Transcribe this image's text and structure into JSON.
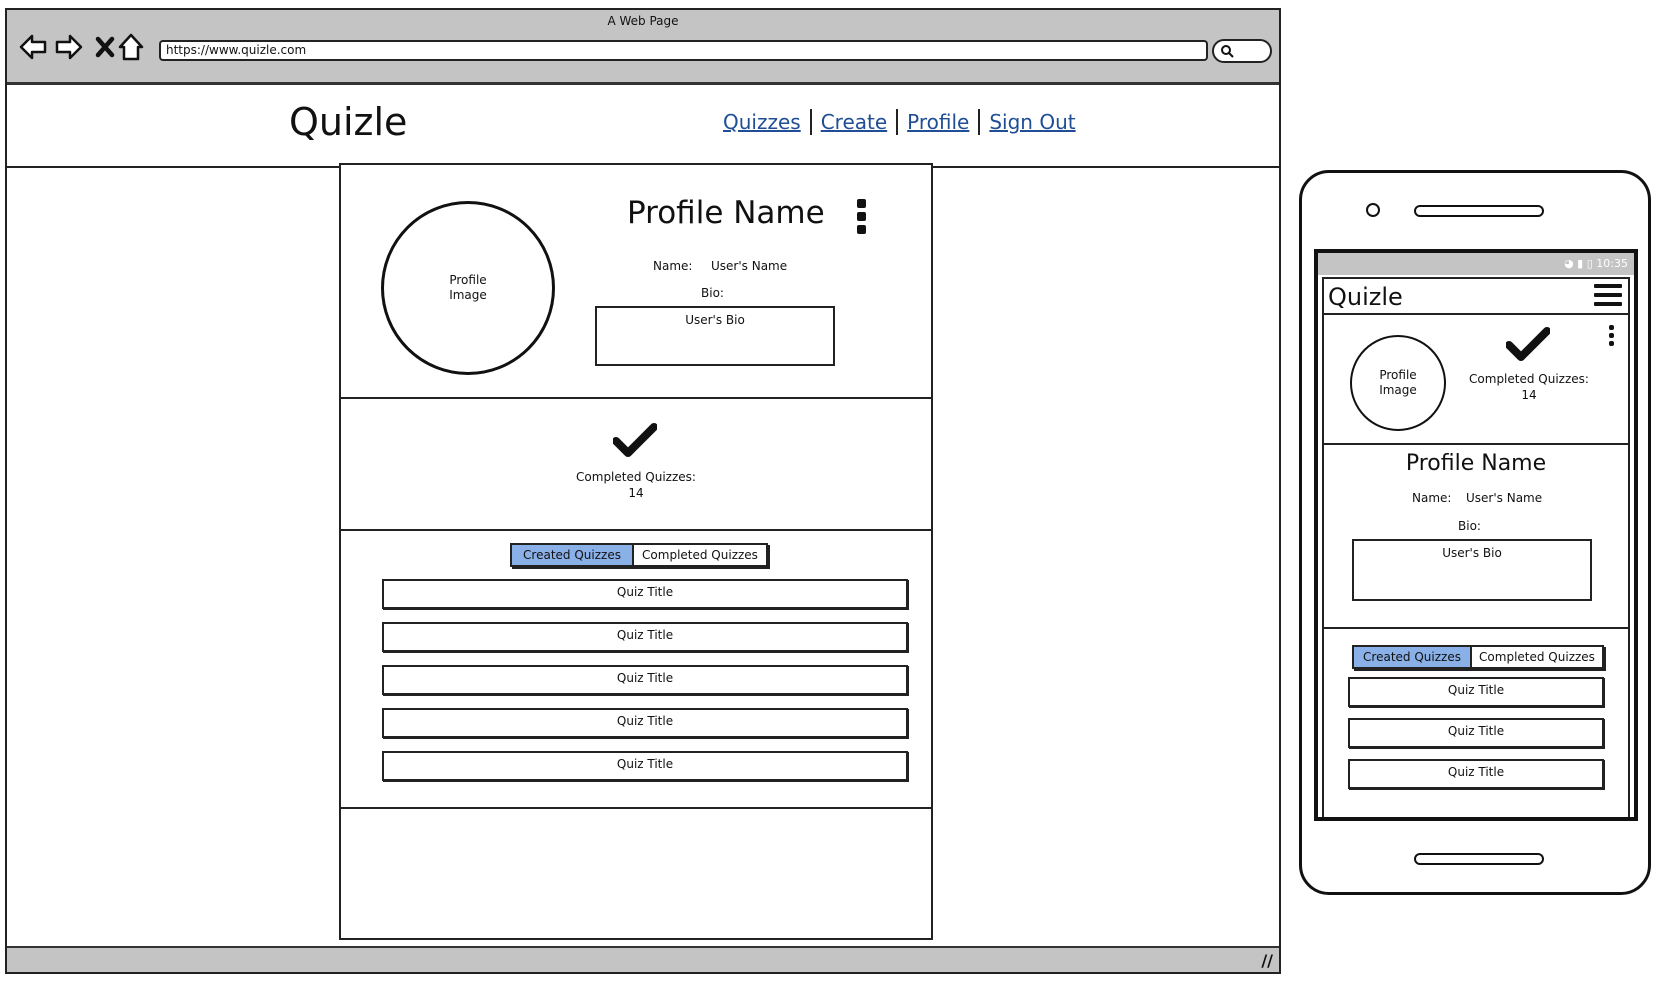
{
  "browser": {
    "window_title": "A Web Page",
    "url": "https://www.quizle.com",
    "icons": [
      "back-arrow-icon",
      "forward-arrow-icon",
      "close-icon",
      "home-icon",
      "search-icon"
    ]
  },
  "site": {
    "logo": "Quizle",
    "nav": [
      "Quizzes",
      "Create",
      "Profile",
      "Sign Out"
    ]
  },
  "profile": {
    "image_label": "Profile Image",
    "name": "Profile Name",
    "name_label": "Name:",
    "name_value": "User's Name",
    "bio_label": "Bio:",
    "bio_value": "User's Bio"
  },
  "stats": {
    "completed_label": "Completed Quizzes:",
    "completed_count": "14"
  },
  "tabs": {
    "created": "Created Quizzes",
    "completed": "Completed Quizzes",
    "active": "created"
  },
  "quizzes": [
    "Quiz Title",
    "Quiz Title",
    "Quiz Title",
    "Quiz Title",
    "Quiz Title"
  ],
  "mobile": {
    "status_time": "10:35",
    "logo": "Quizle",
    "quizzes": [
      "Quiz Title",
      "Quiz Title",
      "Quiz Title"
    ]
  },
  "colors": {
    "active_tab": "#8ab0e8",
    "link": "#1f4e96",
    "chrome": "#c4c4c4"
  }
}
